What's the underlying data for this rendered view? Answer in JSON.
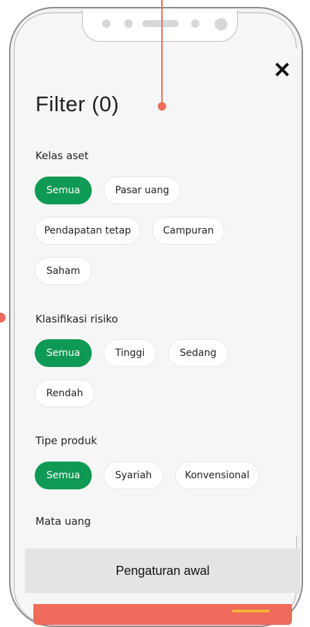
{
  "header": {
    "title": "Filter (0)"
  },
  "sections": [
    {
      "label": "Kelas aset",
      "chips": [
        {
          "label": "Semua",
          "active": true
        },
        {
          "label": "Pasar uang",
          "active": false
        },
        {
          "label": "Pendapatan tetap",
          "active": false
        },
        {
          "label": "Campuran",
          "active": false
        },
        {
          "label": "Saham",
          "active": false
        }
      ]
    },
    {
      "label": "Klasifikasi risiko",
      "chips": [
        {
          "label": "Semua",
          "active": true
        },
        {
          "label": "Tinggi",
          "active": false
        },
        {
          "label": "Sedang",
          "active": false
        },
        {
          "label": "Rendah",
          "active": false
        }
      ]
    },
    {
      "label": "Tipe produk",
      "chips": [
        {
          "label": "Semua",
          "active": true
        },
        {
          "label": "Syariah",
          "active": false
        },
        {
          "label": "Konvensional",
          "active": false
        }
      ]
    },
    {
      "label": "Mata uang",
      "chips": []
    }
  ],
  "footer": {
    "reset_label": "Pengaturan awal"
  },
  "colors": {
    "active": "#0e9a55",
    "annotation": "#ee6a5a",
    "cta": "#ee6a5a"
  },
  "icons": {
    "close": "close-icon"
  }
}
